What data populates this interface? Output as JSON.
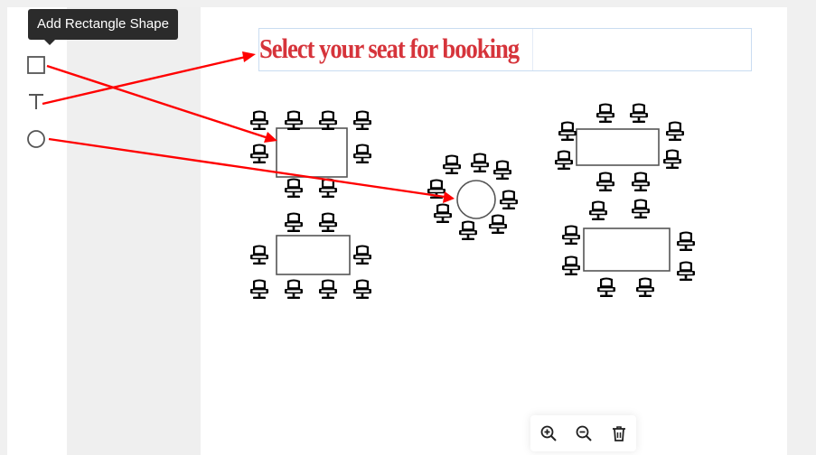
{
  "tooltip": {
    "text": "Add Rectangle Shape"
  },
  "canvas": {
    "title": "Select your seat for booking"
  },
  "toolbar": {
    "tools": [
      {
        "name": "chair-tool",
        "icon": "chair-icon"
      },
      {
        "name": "rectangle-tool",
        "icon": "square-icon"
      },
      {
        "name": "text-tool",
        "icon": "text-icon"
      },
      {
        "name": "circle-tool",
        "icon": "circle-icon"
      }
    ]
  },
  "zoom_controls": [
    {
      "name": "zoom-in-button",
      "icon": "zoom-in-icon"
    },
    {
      "name": "zoom-out-button",
      "icon": "zoom-out-icon"
    },
    {
      "name": "delete-button",
      "icon": "trash-icon"
    }
  ],
  "colors": {
    "title": "#d6343b",
    "annotation": "#ff0000",
    "tooltip_bg": "#2b2b2b",
    "tool_icon": "#555555"
  }
}
